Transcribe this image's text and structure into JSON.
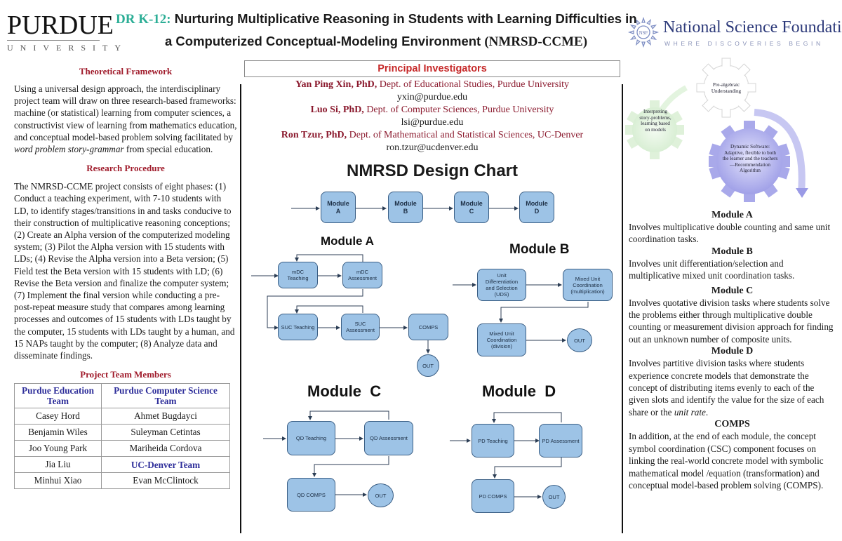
{
  "header": {
    "purdue_logo": {
      "word": "PURDUE",
      "sub": "UNIVERSITY"
    },
    "title_prefix": "DR K-12:",
    "title_line1": " Nurturing Multiplicative Reasoning in Students with Learning Difficulties in",
    "title_line2": "a Computerized Conceptual-Modeling Environment ",
    "title_acronym": "(NMRSD-CCME)",
    "nsf_logo": {
      "name": "National Science Foundation",
      "tagline": "WHERE DISCOVERIES BEGIN",
      "seal_text": "NSF"
    }
  },
  "left": {
    "framework": {
      "heading": "Theoretical Framework",
      "text": "Using a universal design approach, the interdisciplinary project team will draw on three research-based frameworks: machine (or statistical) learning from computer sciences, a constructivist view of learning from mathematics education, and conceptual model-based problem solving facilitated by ",
      "italic": "word problem story-grammar",
      "text_end": " from special education."
    },
    "procedure": {
      "heading": "Research Procedure",
      "text": "The NMRSD-CCME project consists of eight phases: (1) Conduct a teaching experiment, with 7-10 students with LD, to identify stages/transitions in and tasks conducive to their construction of multiplicative reasoning conceptions; (2) Create an Alpha version of the computerized modeling system; (3) Pilot the Alpha version with 15 students with LDs; (4) Revise the Alpha version into a Beta version; (5) Field test the Beta version with 15 students with LD; (6) Revise the Beta version and finalize the computer system; (7) Implement the final version while conducting a pre-post-repeat measure study that compares among learning processes and outcomes of 15 students with LDs taught by the computer, 15 students with LDs taught by a human, and 15 NAPs taught by the computer; (8) Analyze data and disseminate findings."
    },
    "team": {
      "heading": "Project Team Members",
      "col1_header": "Purdue Education Team",
      "col2_header": "Purdue Computer Science Team",
      "rows": [
        [
          "Casey Hord",
          "Ahmet  Bugdayci"
        ],
        [
          "Benjamin Wiles",
          "Suleyman Cetintas"
        ],
        [
          "Joo Young Park",
          "Mariheida Cordova"
        ],
        [
          "Jia Liu",
          "UC-Denver Team"
        ],
        [
          "Minhui Xiao",
          "Evan McClintock"
        ]
      ]
    }
  },
  "middle": {
    "pi_heading": "Principal Investigators",
    "pis": [
      {
        "name": "Yan Ping Xin, PhD,",
        "dept": " Dept. of Educational Studies, Purdue University",
        "email": "yxin@purdue.edu"
      },
      {
        "name": "Luo Si, PhD,",
        "dept": " Dept. of Computer Sciences, Purdue University",
        "email": "lsi@purdue.edu"
      },
      {
        "name": "Ron Tzur, PhD,",
        "dept": " Dept. of Mathematical and Statistical Sciences, UC-Denver",
        "email": "ron.tzur@ucdenver.edu"
      }
    ],
    "chart_title": "NMRSD Design Chart",
    "overview_nodes": [
      "Module\nA",
      "Module\nB",
      "Module\nC",
      "Module\nD"
    ],
    "module_a": {
      "title": "Module A",
      "nodes": [
        "mDC\nTeaching",
        "mDC\nAssessment",
        "SUC Teaching",
        "SUC\nAssessment",
        "COMPS",
        "OUT"
      ]
    },
    "module_b": {
      "title": "Module B",
      "nodes": [
        "Unit\nDifferentiation\nand Selection\n(UDS)",
        "Mixed Unit\nCoordination\n(multiplication)",
        "Mixed Unit\nCoordination\n(division)",
        "OUT"
      ]
    },
    "module_c": {
      "title": "Module  C",
      "nodes": [
        "QD Teaching",
        "QD Assessment",
        "QD COMPS",
        "OUT"
      ]
    },
    "module_d": {
      "title": "Module  D",
      "nodes": [
        "PD Teaching",
        "PD Assessment",
        "PD COMPS",
        "OUT"
      ]
    }
  },
  "right": {
    "gears": [
      {
        "label": "Pre-algebraic Understanding",
        "color": "#ffffff"
      },
      {
        "label": "Interpreting story-problems, learning based on models",
        "color": "#e3f4df"
      },
      {
        "label": "Dynamic Software: Adaptive, flexible to both the learner and the teachers—Recommendation Algorithm",
        "color": "#b5b5ee"
      }
    ],
    "sections": [
      {
        "heading": "Module A",
        "text": "Involves multiplicative double counting and same unit coordination tasks."
      },
      {
        "heading": "Module B",
        "text": "Involves unit differentiation/selection and multiplicative mixed unit coordination tasks."
      },
      {
        "heading": "Module C",
        "text": "Involves quotative division tasks where students solve the problems either through multiplicative double counting or measurement division approach for finding out an unknown number of composite units."
      },
      {
        "heading": "Module D",
        "text": "Involves partitive division tasks where students experience concrete models that demonstrate the concept of distributing items evenly to each of the given slots and identify the value for the size of each share or the ",
        "italic": "unit rate",
        "text_end": "."
      },
      {
        "heading": "COMPS",
        "text": "In addition, at the end of each module, the concept symbol coordination (CSC) component focuses on linking the real-world concrete model with symbolic mathematical model /equation (transformation) and conceptual model-based problem solving (COMPS)."
      }
    ]
  },
  "colors": {
    "heading_red": "#a01c2c",
    "pi_red": "#c62828",
    "title_teal": "#2cae96",
    "team_blue": "#2e2e9a",
    "node_fill": "#9dc3e6",
    "node_border": "#3a5e84"
  }
}
